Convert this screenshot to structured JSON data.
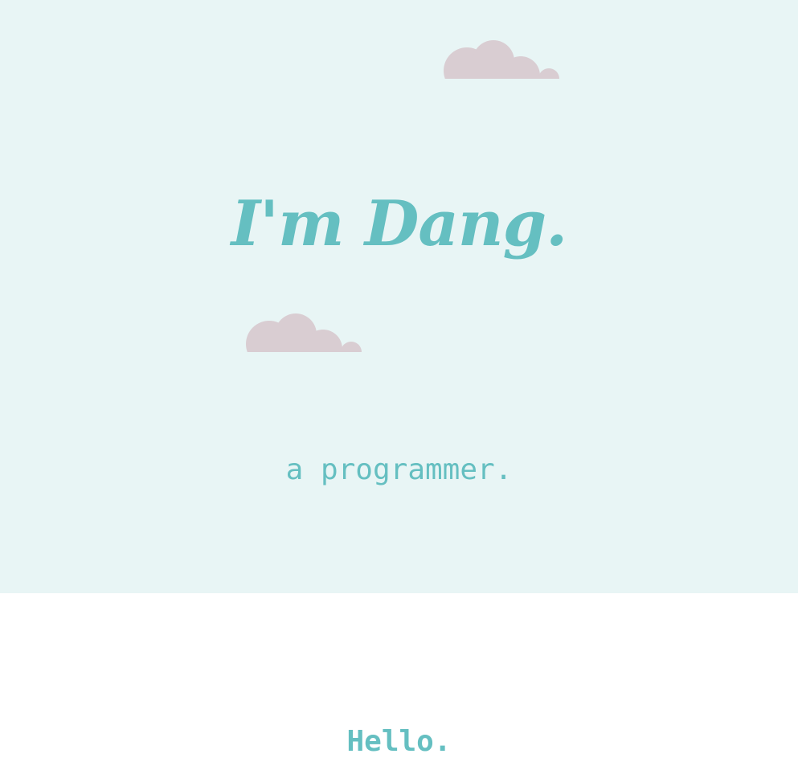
{
  "hero": {
    "title": "I'm Dang.",
    "subtitle": "a programmer."
  },
  "intro": {
    "heading": "Hello."
  },
  "colors": {
    "hero_background": "#e8f5f5",
    "accent_teal": "#65bfc1",
    "cloud_pink": "#d9cdd2",
    "page_background": "#ffffff"
  },
  "icons": [
    "cloud-icon"
  ]
}
